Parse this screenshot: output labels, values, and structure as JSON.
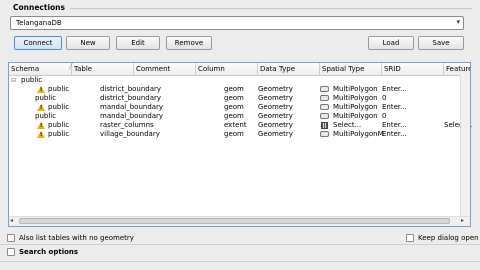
{
  "connections": {
    "group_title": "Connections",
    "selected": "TelanganaDB",
    "buttons": {
      "connect": "Connect",
      "new": "New",
      "edit": "Edit",
      "remove": "Remove",
      "load": "Load",
      "save": "Save"
    }
  },
  "table": {
    "columns": [
      "Schema",
      "Table",
      "Comment",
      "Column",
      "Data Type",
      "Spatial Type",
      "SRID",
      "Feature i"
    ],
    "group": "public",
    "rows": [
      {
        "schema": "public",
        "table": "district_boundary",
        "comment": "",
        "column": "geom",
        "data_type": "Geometry",
        "spatial_type": "MultiPolygon",
        "srid": "Enter...",
        "feature": "",
        "warning": true,
        "icon": "polygon-icon"
      },
      {
        "schema": "public",
        "table": "district_boundary",
        "comment": "",
        "column": "geom",
        "data_type": "Geometry",
        "spatial_type": "MultiPolygon",
        "srid": "0",
        "feature": "",
        "warning": false,
        "icon": "polygon-icon"
      },
      {
        "schema": "public",
        "table": "mandal_boundary",
        "comment": "",
        "column": "geom",
        "data_type": "Geometry",
        "spatial_type": "MultiPolygon",
        "srid": "Enter...",
        "feature": "",
        "warning": true,
        "icon": "polygon-icon"
      },
      {
        "schema": "public",
        "table": "mandal_boundary",
        "comment": "",
        "column": "geom",
        "data_type": "Geometry",
        "spatial_type": "MultiPolygon",
        "srid": "0",
        "feature": "",
        "warning": false,
        "icon": "polygon-icon"
      },
      {
        "schema": "public",
        "table": "raster_columns",
        "comment": "",
        "column": "extent",
        "data_type": "Geometry",
        "spatial_type": "Select...",
        "srid": "Enter...",
        "feature": "Select...",
        "warning": true,
        "icon": "raster-icon"
      },
      {
        "schema": "public",
        "table": "village_boundary",
        "comment": "",
        "column": "geom",
        "data_type": "Geometry",
        "spatial_type": "MultiPolygonM",
        "srid": "Enter...",
        "feature": "",
        "warning": true,
        "icon": "polygon-icon"
      }
    ]
  },
  "options": {
    "list_no_geometry": "Also list tables with no geometry",
    "keep_dialog_open": "Keep dialog open",
    "search_options": "Search options"
  },
  "colors": {
    "warning": "#e8b400",
    "selection_border": "#7aa0c8"
  }
}
